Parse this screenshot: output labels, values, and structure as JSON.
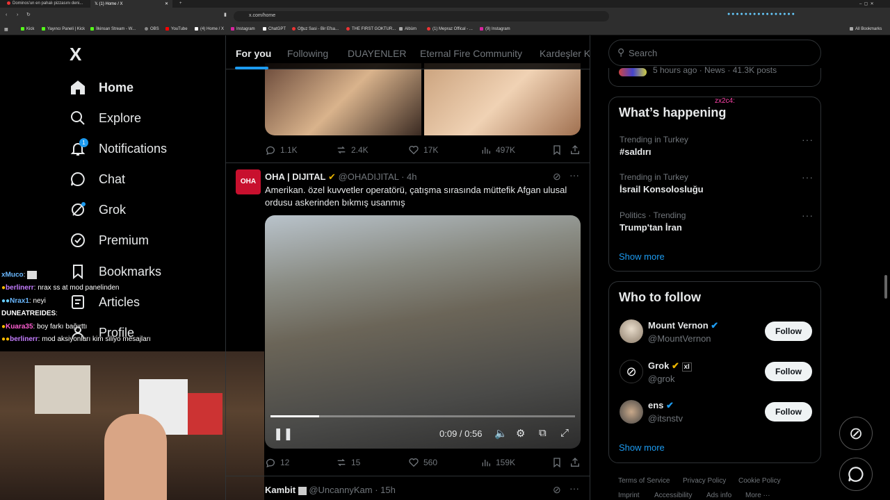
{
  "browser": {
    "tabs": [
      {
        "title": "Dominos'un en pahalı pizzasını deni..."
      },
      {
        "title": "(1) Home / X"
      }
    ],
    "url": "x.com/home",
    "bookmarks": [
      "Kick",
      "Yayıncı Paneli | Kick",
      "İlkinsan Stream - W...",
      "OBS",
      "YouTube",
      "(4) Home / X",
      "Instagram",
      "ChatGPT",
      "Oğuz Sasi - Bir Efsa...",
      "THE FIRST GOKTUR...",
      "Albüm",
      "(1) Mepraz Offical - ...",
      "(9) Instagram"
    ],
    "all_bookmarks": "All Bookmarks"
  },
  "nav": {
    "logo": "X",
    "items": [
      {
        "label": "Home",
        "icon": "home-icon"
      },
      {
        "label": "Explore",
        "icon": "search-icon"
      },
      {
        "label": "Notifications",
        "icon": "bell-icon"
      },
      {
        "label": "Chat",
        "icon": "chat-icon"
      },
      {
        "label": "Grok",
        "icon": "grok-icon"
      },
      {
        "label": "Premium",
        "icon": "premium-icon"
      },
      {
        "label": "Bookmarks",
        "icon": "bookmark-icon"
      },
      {
        "label": "Articles",
        "icon": "articles-icon"
      },
      {
        "label": "Profile",
        "icon": "profile-icon"
      }
    ],
    "notification_count": "1"
  },
  "stream_chat": [
    {
      "user": "xMuco",
      "msg": ""
    },
    {
      "user": "berlinerr",
      "msg": "nrax ss at mod panelinden"
    },
    {
      "user": "Nrax1",
      "msg": "neyi"
    },
    {
      "user": "DUNEATREIDES",
      "msg": ""
    },
    {
      "user": "Kuara35",
      "msg": "boy farkı bağırttı"
    },
    {
      "user": "berlinerr",
      "msg": "mod aksiyonları kim siliyo mesajları"
    }
  ],
  "feed": {
    "tabs": [
      "For you",
      "Following",
      "DUAYENLER",
      "Eternal Fire Community",
      "Kardeşler K"
    ],
    "post1": {
      "replies": "1.1K",
      "reposts": "2.4K",
      "likes": "17K",
      "views": "497K"
    },
    "post2": {
      "name": "OHA | DIJITAL",
      "handle": "@OHADIJITAL",
      "time": "· 4h",
      "avatar_text": "OHA",
      "text": "Amerikan. özel kuvvetler operatörü, çatışma sırasında müttefik Afgan ulusal ordusu askerinden bıkmış usanmış",
      "video_time": "0:09 / 0:56",
      "progress": 0.16,
      "replies": "12",
      "reposts": "15",
      "likes": "560",
      "views": "159K"
    },
    "post3": {
      "name": "Kambit",
      "handle": "@UncannyKam",
      "time": "· 15h"
    }
  },
  "sidebar": {
    "search_placeholder": "Search",
    "top_meta": "5 hours ago · News · 41.3K posts",
    "whats_happening": "What’s happening",
    "trends": [
      {
        "context": "Trending in Turkey",
        "name": "#saldırı"
      },
      {
        "context": "Trending in Turkey",
        "name": "İsrail Konsolosluğu"
      },
      {
        "context": "Politics · Trending",
        "name": "Trump'tan İran"
      }
    ],
    "show_more": "Show more",
    "who_to_follow": "Who to follow",
    "follows": [
      {
        "name": "Mount Vernon",
        "handle": "@MountVernon"
      },
      {
        "name": "Grok",
        "handle": "@grok"
      },
      {
        "name": "ens",
        "handle": "@itsnstv"
      }
    ],
    "follow_label": "Follow",
    "footer": [
      "Terms of Service",
      "Privacy Policy",
      "Cookie Policy",
      "Imprint",
      "Accessibility",
      "Ads info",
      "More ···"
    ],
    "overlay_tag": "zx2c4:"
  }
}
